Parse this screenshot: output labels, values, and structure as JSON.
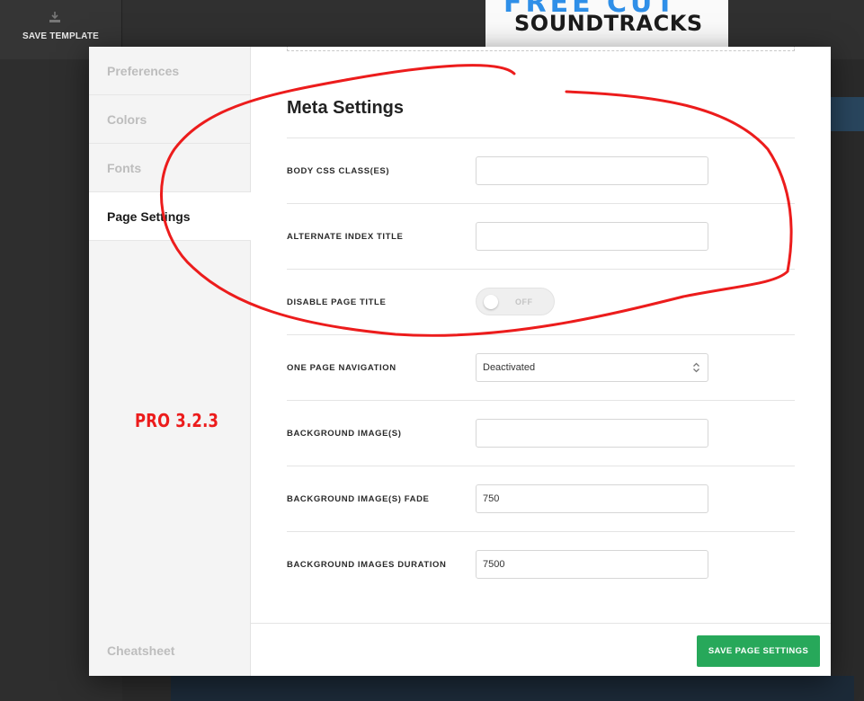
{
  "background": {
    "save_template_label": "SAVE TEMPLATE",
    "logo_text": "SOUNDTRACKS"
  },
  "sidebar": {
    "items": [
      {
        "label": "Preferences"
      },
      {
        "label": "Colors"
      },
      {
        "label": "Fonts"
      },
      {
        "label": "Page Settings"
      }
    ],
    "cheatsheet": "Cheatsheet"
  },
  "annotation": {
    "version_label": "PRO 3.2.3",
    "color": "#ec1c1c"
  },
  "meta": {
    "title": "Meta Settings",
    "body_css": {
      "label": "BODY CSS CLASS(ES)",
      "value": ""
    },
    "alt_title": {
      "label": "ALTERNATE INDEX TITLE",
      "value": ""
    },
    "disable_title": {
      "label": "DISABLE PAGE TITLE",
      "state": "OFF"
    },
    "one_page_nav": {
      "label": "ONE PAGE NAVIGATION",
      "value": "Deactivated"
    },
    "bg_images": {
      "label": "BACKGROUND IMAGE(S)",
      "value": ""
    },
    "bg_fade": {
      "label": "BACKGROUND IMAGE(S) FADE",
      "value": "750"
    },
    "bg_duration": {
      "label": "BACKGROUND IMAGES DURATION",
      "value": "7500"
    }
  },
  "footer": {
    "save_label": "SAVE PAGE SETTINGS",
    "save_color": "#27a85a"
  }
}
